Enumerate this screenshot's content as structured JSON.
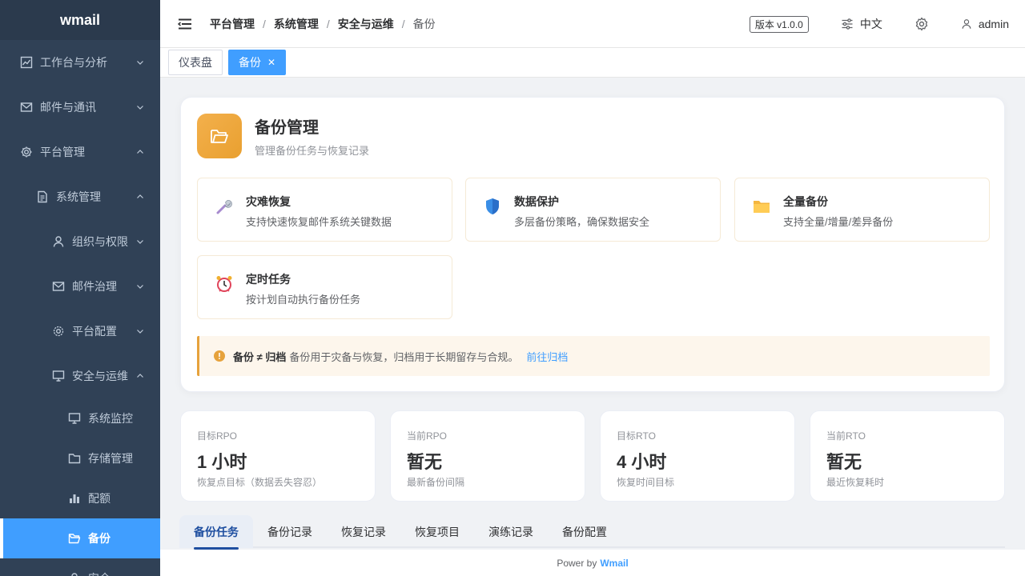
{
  "app": {
    "logo": "wmail"
  },
  "sidebar": {
    "items": [
      {
        "label": "工作台与分析",
        "icon": "chart-icon"
      },
      {
        "label": "邮件与通讯",
        "icon": "mail-icon"
      },
      {
        "label": "平台管理",
        "icon": "gear-icon"
      },
      {
        "label": "系统管理",
        "icon": "document-icon"
      },
      {
        "label": "组织与权限",
        "icon": "user-icon"
      },
      {
        "label": "邮件治理",
        "icon": "mail-icon"
      },
      {
        "label": "平台配置",
        "icon": "gear-icon"
      },
      {
        "label": "安全与运维",
        "icon": "monitor-icon"
      },
      {
        "label": "系统监控",
        "icon": "monitor-icon"
      },
      {
        "label": "存储管理",
        "icon": "folder-icon"
      },
      {
        "label": "配额",
        "icon": "bar-chart-icon"
      },
      {
        "label": "备份",
        "icon": "folder-open-icon"
      },
      {
        "label": "安全",
        "icon": "lock-icon"
      }
    ]
  },
  "header": {
    "breadcrumb": [
      "平台管理",
      "系统管理",
      "安全与运维",
      "备份"
    ],
    "version": "版本 v1.0.0",
    "language": "中文",
    "user": "admin"
  },
  "tags": [
    {
      "label": "仪表盘"
    },
    {
      "label": "备份",
      "close": "✕"
    }
  ],
  "panel": {
    "title": "备份管理",
    "subtitle": "管理备份任务与恢复记录",
    "features": [
      {
        "title": "灾难恢复",
        "desc": "支持快速恢复邮件系统关键数据",
        "icon": "wrench-icon"
      },
      {
        "title": "数据保护",
        "desc": "多层备份策略，确保数据安全",
        "icon": "shield-icon"
      },
      {
        "title": "全量备份",
        "desc": "支持全量/增量/差异备份",
        "icon": "folder-icon"
      },
      {
        "title": "定时任务",
        "desc": "按计划自动执行备份任务",
        "icon": "alarm-clock-icon"
      }
    ],
    "alert": {
      "strong": "备份 ≠ 归档",
      "text": "备份用于灾备与恢复，归档用于长期留存与合规。",
      "link": "前往归档"
    }
  },
  "stats": [
    {
      "label": "目标RPO",
      "value": "1 小时",
      "desc": "恢复点目标（数据丢失容忍）"
    },
    {
      "label": "当前RPO",
      "value": "暂无",
      "desc": "最新备份间隔"
    },
    {
      "label": "目标RTO",
      "value": "4 小时",
      "desc": "恢复时间目标"
    },
    {
      "label": "当前RTO",
      "value": "暂无",
      "desc": "最近恢复耗时"
    }
  ],
  "tabs": [
    "备份任务",
    "备份记录",
    "恢复记录",
    "恢复项目",
    "演练记录",
    "备份配置"
  ],
  "footer": {
    "prefix": "Power by",
    "brand": "Wmail"
  }
}
